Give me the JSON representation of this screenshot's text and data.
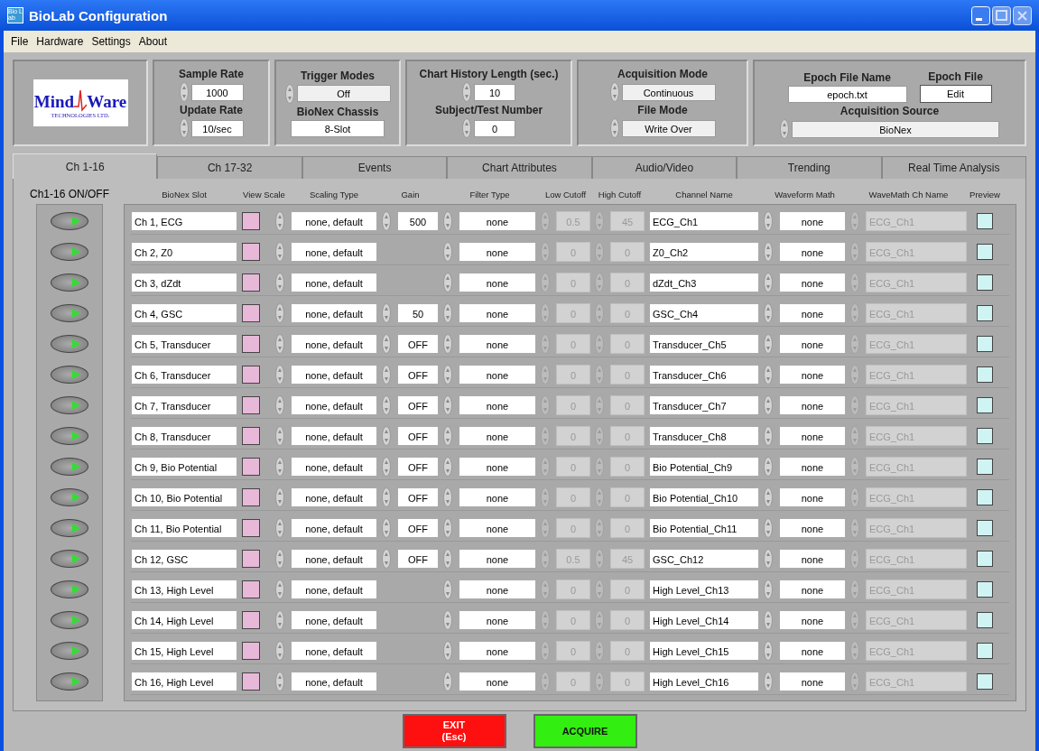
{
  "window": {
    "title": "BioLab Configuration",
    "app_icon": "Bio Lab"
  },
  "menu": [
    "File",
    "Hardware",
    "Settings",
    "About"
  ],
  "logo": {
    "name_1": "Mind",
    "name_2": "Ware",
    "tagline": "TECHNOLOGIES LTD."
  },
  "settings": {
    "sample_rate": {
      "label": "Sample Rate",
      "value": "1000"
    },
    "update_rate": {
      "label": "Update Rate",
      "value": "10/sec"
    },
    "trigger_modes": {
      "label": "Trigger Modes",
      "value": "Off"
    },
    "chassis": {
      "label": "BioNex Chassis",
      "value": "8-Slot"
    },
    "chart_history": {
      "label": "Chart History Length (sec.)",
      "value": "10"
    },
    "subject": {
      "label": "Subject/Test Number",
      "value": "0"
    },
    "acquisition_mode": {
      "label": "Acquisition Mode",
      "value": "Continuous"
    },
    "file_mode": {
      "label": "File Mode",
      "value": "Write Over"
    },
    "epoch_file_name": {
      "label": "Epoch File Name",
      "value": "epoch.txt"
    },
    "epoch_file": {
      "label": "Epoch File",
      "button": "Edit"
    },
    "acquisition_source": {
      "label": "Acquisition Source",
      "value": "BioNex"
    }
  },
  "tabs": [
    {
      "label": "Ch 1-16",
      "selected": true
    },
    {
      "label": "Ch 17-32",
      "selected": false
    },
    {
      "label": "Events",
      "selected": false
    },
    {
      "label": "Chart Attributes",
      "selected": false
    },
    {
      "label": "Audio/Video",
      "selected": false
    },
    {
      "label": "Trending",
      "selected": false
    },
    {
      "label": "Real Time Analysis",
      "selected": false
    }
  ],
  "onoff_label": "Ch1-16 ON/OFF",
  "columns": [
    "BioNex Slot",
    "View Scale",
    "Scaling Type",
    "Gain",
    "Filter Type",
    "Low Cutoff",
    "High Cutoff",
    "Channel Name",
    "Waveform Math",
    "WaveMath Ch Name",
    "Preview"
  ],
  "rows": [
    {
      "on": true,
      "slot": "Ch 1, ECG",
      "scaling": "none, default",
      "gain": "500",
      "filter": "none",
      "low": "0.5",
      "high": "45",
      "name": "ECG_Ch1",
      "math": "none",
      "math_name": "ECG_Ch1",
      "preview": false
    },
    {
      "on": true,
      "slot": "Ch 2, Z0",
      "scaling": "none, default",
      "filter": "none",
      "low": "0",
      "high": "0",
      "name": "Z0_Ch2",
      "math": "none",
      "math_name": "ECG_Ch1",
      "preview": false
    },
    {
      "on": true,
      "slot": "Ch 3, dZdt",
      "scaling": "none, default",
      "filter": "none",
      "low": "0",
      "high": "0",
      "name": "dZdt_Ch3",
      "math": "none",
      "math_name": "ECG_Ch1",
      "preview": false
    },
    {
      "on": true,
      "slot": "Ch 4, GSC",
      "scaling": "none, default",
      "gain": "50",
      "filter": "none",
      "low": "0",
      "high": "0",
      "name": "GSC_Ch4",
      "math": "none",
      "math_name": "ECG_Ch1",
      "preview": false
    },
    {
      "on": true,
      "slot": "Ch 5, Transducer",
      "scaling": "none, default",
      "gain": "OFF",
      "filter": "none",
      "low": "0",
      "high": "0",
      "name": "Transducer_Ch5",
      "math": "none",
      "math_name": "ECG_Ch1",
      "preview": false
    },
    {
      "on": true,
      "slot": "Ch 6, Transducer",
      "scaling": "none, default",
      "gain": "OFF",
      "filter": "none",
      "low": "0",
      "high": "0",
      "name": "Transducer_Ch6",
      "math": "none",
      "math_name": "ECG_Ch1",
      "preview": false
    },
    {
      "on": true,
      "slot": "Ch 7, Transducer",
      "scaling": "none, default",
      "gain": "OFF",
      "filter": "none",
      "low": "0",
      "high": "0",
      "name": "Transducer_Ch7",
      "math": "none",
      "math_name": "ECG_Ch1",
      "preview": false
    },
    {
      "on": true,
      "slot": "Ch 8, Transducer",
      "scaling": "none, default",
      "gain": "OFF",
      "filter": "none",
      "low": "0",
      "high": "0",
      "name": "Transducer_Ch8",
      "math": "none",
      "math_name": "ECG_Ch1",
      "preview": false
    },
    {
      "on": true,
      "slot": "Ch 9, Bio Potential",
      "scaling": "none, default",
      "gain": "OFF",
      "filter": "none",
      "low": "0",
      "high": "0",
      "name": "Bio Potential_Ch9",
      "math": "none",
      "math_name": "ECG_Ch1",
      "preview": false
    },
    {
      "on": true,
      "slot": "Ch 10, Bio Potential",
      "scaling": "none, default",
      "gain": "OFF",
      "filter": "none",
      "low": "0",
      "high": "0",
      "name": "Bio Potential_Ch10",
      "math": "none",
      "math_name": "ECG_Ch1",
      "preview": false
    },
    {
      "on": true,
      "slot": "Ch 11, Bio Potential",
      "scaling": "none, default",
      "gain": "OFF",
      "filter": "none",
      "low": "0",
      "high": "0",
      "name": "Bio Potential_Ch11",
      "math": "none",
      "math_name": "ECG_Ch1",
      "preview": false
    },
    {
      "on": true,
      "slot": "Ch 12, GSC",
      "scaling": "none, default",
      "gain": "OFF",
      "filter": "none",
      "low": "0.5",
      "high": "45",
      "name": "GSC_Ch12",
      "math": "none",
      "math_name": "ECG_Ch1",
      "preview": false
    },
    {
      "on": true,
      "slot": "Ch 13, High Level",
      "scaling": "none, default",
      "filter": "none",
      "low": "0",
      "high": "0",
      "name": "High Level_Ch13",
      "math": "none",
      "math_name": "ECG_Ch1",
      "preview": false
    },
    {
      "on": true,
      "slot": "Ch 14, High Level",
      "scaling": "none, default",
      "filter": "none",
      "low": "0",
      "high": "0",
      "name": "High Level_Ch14",
      "math": "none",
      "math_name": "ECG_Ch1",
      "preview": false
    },
    {
      "on": true,
      "slot": "Ch 15, High Level",
      "scaling": "none, default",
      "filter": "none",
      "low": "0",
      "high": "0",
      "name": "High Level_Ch15",
      "math": "none",
      "math_name": "ECG_Ch1",
      "preview": false
    },
    {
      "on": true,
      "slot": "Ch 16, High Level",
      "scaling": "none, default",
      "filter": "none",
      "low": "0",
      "high": "0",
      "name": "High Level_Ch16",
      "math": "none",
      "math_name": "ECG_Ch1",
      "preview": false
    }
  ],
  "buttons": {
    "exit": {
      "line_1": "EXIT",
      "line_2": "(Esc)"
    },
    "acquire": "ACQUIRE"
  }
}
